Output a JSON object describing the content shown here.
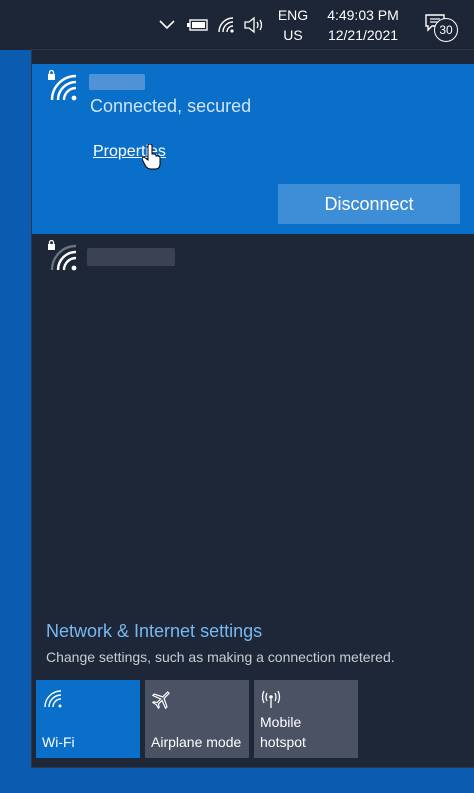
{
  "taskbar": {
    "lang_top": "ENG",
    "lang_bottom": "US",
    "time": "4:49:03 PM",
    "date": "12/21/2021",
    "notification_count": "30"
  },
  "flyout": {
    "connected_network": {
      "status": "Connected, secured",
      "properties_label": "Properties",
      "disconnect_label": "Disconnect"
    },
    "settings": {
      "title": "Network & Internet settings",
      "subtitle": "Change settings, such as making a connection metered."
    },
    "tiles": [
      {
        "label": "Wi-Fi",
        "icon": "wifi-icon",
        "active": true
      },
      {
        "label": "Airplane mode",
        "icon": "airplane-icon",
        "active": false
      },
      {
        "label": "Mobile hotspot",
        "icon": "hotspot-icon",
        "active": false
      }
    ]
  },
  "colors": {
    "taskbar": "#1c2637",
    "flyout_bg": "#1e2737",
    "accent": "#0a6fc9",
    "button": "#3d8ed6",
    "link": "#78b8f2",
    "tile": "#4a5263",
    "desktop": "#0b5cb1"
  }
}
